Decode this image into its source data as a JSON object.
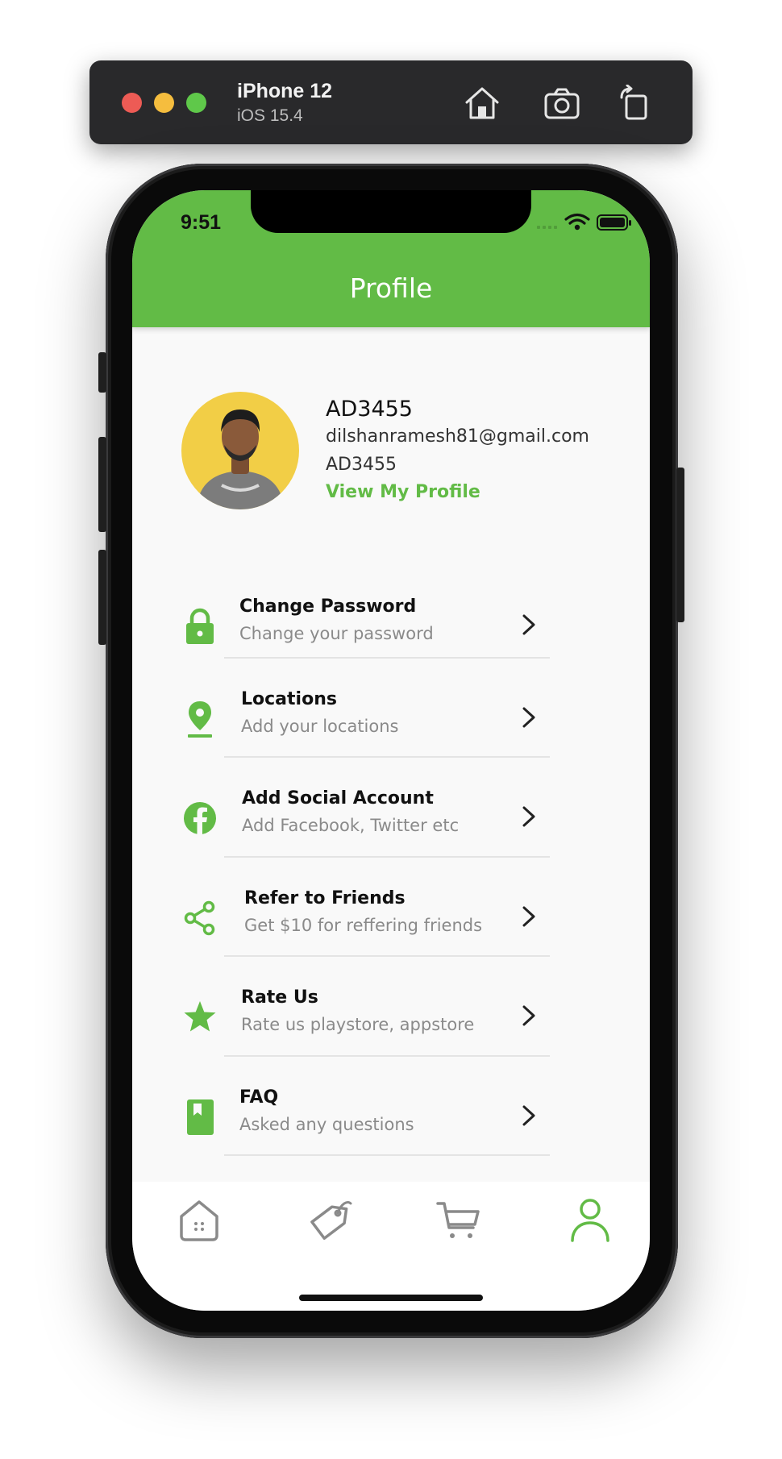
{
  "simulator": {
    "device_name": "iPhone 12",
    "os_version": "iOS 15.4"
  },
  "status_bar": {
    "time": "9:51"
  },
  "header": {
    "title": "Profile"
  },
  "profile": {
    "name": "AD3455",
    "email": "dilshanramesh81@gmail.com",
    "user_id": "AD3455",
    "view_link": "View My Profile"
  },
  "menu": [
    {
      "icon": "lock-icon",
      "title": "Change Password",
      "subtitle": "Change your password"
    },
    {
      "icon": "location-pin-icon",
      "title": "Locations",
      "subtitle": "Add your locations"
    },
    {
      "icon": "facebook-icon",
      "title": "Add Social Account",
      "subtitle": "Add Facebook, Twitter etc"
    },
    {
      "icon": "share-icon",
      "title": "Refer to Friends",
      "subtitle": "Get $10 for reffering friends"
    },
    {
      "icon": "star-icon",
      "title": "Rate Us",
      "subtitle": "Rate us playstore, appstore"
    },
    {
      "icon": "bookmark-book-icon",
      "title": "FAQ",
      "subtitle": "Asked any questions"
    }
  ],
  "bottom_nav": [
    {
      "icon": "home-icon",
      "active": false
    },
    {
      "icon": "tag-icon",
      "active": false
    },
    {
      "icon": "cart-icon",
      "active": false
    },
    {
      "icon": "user-icon",
      "active": true
    }
  ],
  "colors": {
    "accent": "#62bb46",
    "inactive_icon": "#8a8a8a",
    "background": "#f9f9f9"
  }
}
